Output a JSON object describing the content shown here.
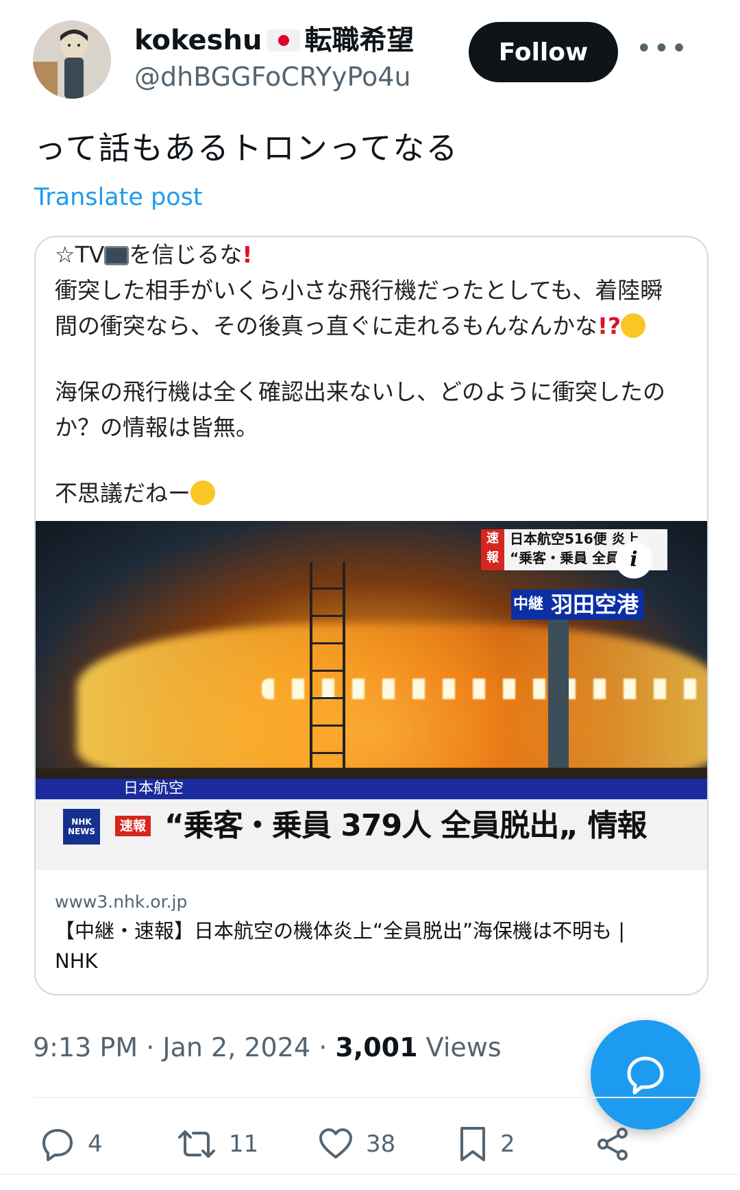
{
  "author": {
    "display_name": "kokeshu",
    "flag": "Japan flag",
    "display_suffix": "転職希望",
    "handle": "@dhBGGFoCRYyPo4u",
    "avatar": "kokeshi-doll-avatar"
  },
  "header": {
    "follow_label": "Follow",
    "more_icon": "more-horizontal-icon"
  },
  "post": {
    "text": "って話もあるトロンってなる",
    "translate_label": "Translate post"
  },
  "card": {
    "line1_prefix": "☆TV",
    "line1_suffix": "を信じるな",
    "line2": "衝突した相手がいくら小さな飛行機だったとしても、着陸瞬",
    "line3": "間の衝突なら、その後真っ直ぐに走れるもんなんかな",
    "line4": "海保の飛行機は全く確認出来ないし、どのように衝突したの",
    "line5": "か？の情報は皆無。",
    "line6": "不思議だねー",
    "image": {
      "breaking_tag": "速報",
      "breaking_line1": "日本航空516便 炎上",
      "breaking_line2": "“乗客・乗員 全員脱出",
      "live_tag": "中継",
      "live_place": "羽田空港",
      "bottom_label": "日本航空",
      "nhk_logo": "NHK NEWS",
      "headline_tag": "速報",
      "headline": "“乗客・乗員 379人 全員脱出„ 情報"
    },
    "domain": "www3.nhk.or.jp",
    "title": "【中継・速報】日本航空の機体炎上“全員脱出”海保機は不明も | NHK"
  },
  "meta": {
    "time": "9:13 PM",
    "date": "Jan 2, 2024",
    "views_count": "3,001",
    "views_label": "Views"
  },
  "actions": {
    "replies": "4",
    "reposts": "11",
    "likes": "38",
    "bookmarks": "2"
  },
  "colors": {
    "accent": "#1d9bf0",
    "text_secondary": "#536471",
    "button_dark": "#0f1419"
  }
}
